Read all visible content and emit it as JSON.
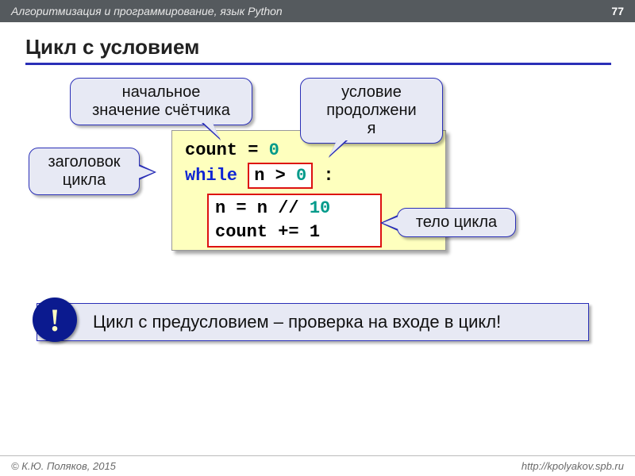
{
  "header": {
    "course": "Алгоритмизация и программирование, язык Python",
    "page": "77"
  },
  "title": "Цикл с условием",
  "callouts": {
    "initial": "начальное\nзначение счётчика",
    "condition": "условие\nпродолжени\nя",
    "loop_header": "заголовок\nцикла",
    "body": "тело цикла"
  },
  "code": {
    "l1_a": "count = ",
    "l1_b": "0",
    "l2_kw": "while",
    "l2_cond_a": "n > ",
    "l2_cond_b": "0",
    "l2_tail": " :",
    "body_l1_a": "n = n // ",
    "body_l1_b": "10",
    "body_l2": "count += 1"
  },
  "note": "Цикл с предусловием – проверка на входе в цикл!",
  "bang": "!",
  "footer": {
    "author": "© К.Ю. Поляков, 2015",
    "url": "http://kpolyakov.spb.ru"
  }
}
